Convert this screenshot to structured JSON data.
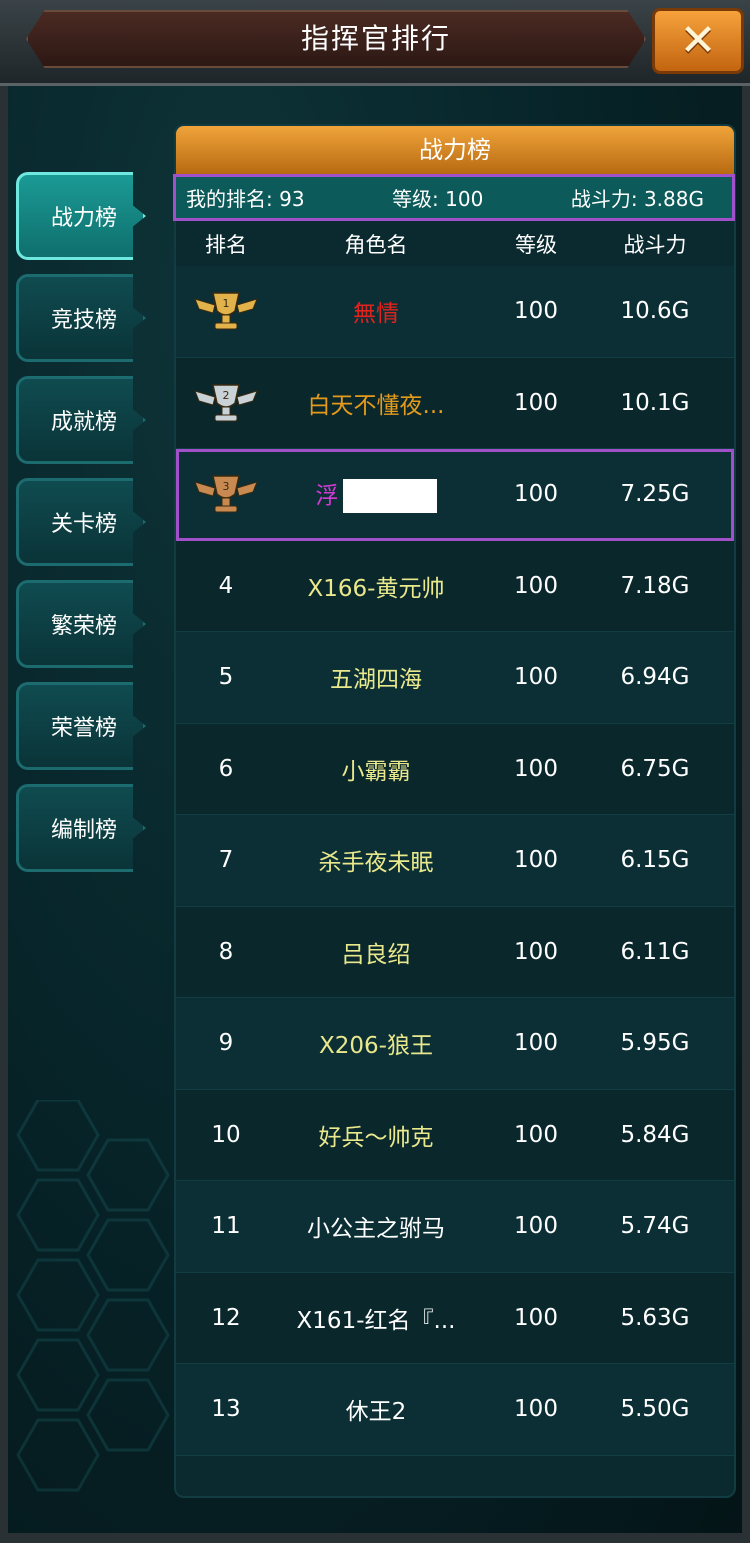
{
  "window": {
    "title": "指挥官排行"
  },
  "close_icon": "close-icon",
  "tabs": [
    {
      "label": "战力榜",
      "active": true
    },
    {
      "label": "竞技榜",
      "active": false
    },
    {
      "label": "成就榜",
      "active": false
    },
    {
      "label": "关卡榜",
      "active": false
    },
    {
      "label": "繁荣榜",
      "active": false
    },
    {
      "label": "荣誉榜",
      "active": false
    },
    {
      "label": "编制榜",
      "active": false
    }
  ],
  "panel": {
    "title": "战力榜",
    "my_rank": {
      "rank": "我的排名: 93",
      "level": "等级: 100",
      "power": "战斗力: 3.88G"
    },
    "columns": {
      "rank": "排名",
      "name": "角色名",
      "level": "等级",
      "power": "战斗力"
    }
  },
  "colors": {
    "red": "#e0231c",
    "orange": "#e49a1a",
    "purple": "#d23cd6",
    "yellow": "#e9e88c",
    "white": "#ffffff",
    "gold": "#e2b34a",
    "silver": "#c9d2d6",
    "bronze": "#c98a52"
  },
  "rows": [
    {
      "rank": "",
      "medal": "1",
      "medal_icon": "gold-trophy-icon",
      "name": "無情",
      "name_color": "red",
      "level": "100",
      "power": "10.6G"
    },
    {
      "rank": "",
      "medal": "2",
      "medal_icon": "silver-trophy-icon",
      "name": "白天不懂夜...",
      "name_color": "orange",
      "level": "100",
      "power": "10.1G"
    },
    {
      "rank": "",
      "medal": "3",
      "medal_icon": "bronze-trophy-icon",
      "name": "浮",
      "name_color": "purple",
      "redacted": true,
      "level": "100",
      "power": "7.25G"
    },
    {
      "rank": "4",
      "name": "X166-黄元帅",
      "name_color": "yellow",
      "level": "100",
      "power": "7.18G"
    },
    {
      "rank": "5",
      "name": "五湖四海",
      "name_color": "yellow",
      "level": "100",
      "power": "6.94G"
    },
    {
      "rank": "6",
      "name": "小霸霸",
      "name_color": "yellow",
      "level": "100",
      "power": "6.75G"
    },
    {
      "rank": "7",
      "name": "杀手夜未眠",
      "name_color": "yellow",
      "level": "100",
      "power": "6.15G"
    },
    {
      "rank": "8",
      "name": "吕良绍",
      "name_color": "yellow",
      "level": "100",
      "power": "6.11G"
    },
    {
      "rank": "9",
      "name": "X206-狼王",
      "name_color": "yellow",
      "level": "100",
      "power": "5.95G"
    },
    {
      "rank": "10",
      "name": "好兵～帅克",
      "name_color": "yellow",
      "level": "100",
      "power": "5.84G"
    },
    {
      "rank": "11",
      "name": "小公主之驸马",
      "name_color": "white",
      "level": "100",
      "power": "5.74G"
    },
    {
      "rank": "12",
      "name": "X161-红名『...",
      "name_color": "white",
      "level": "100",
      "power": "5.63G"
    },
    {
      "rank": "13",
      "name": "休王2",
      "name_color": "white",
      "level": "100",
      "power": "5.50G"
    }
  ]
}
